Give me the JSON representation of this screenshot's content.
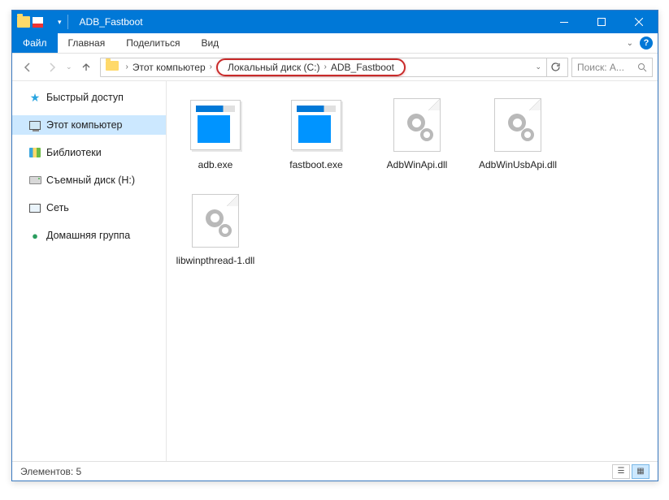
{
  "title": "ADB_Fastboot",
  "ribbon": {
    "file": "Файл",
    "home": "Главная",
    "share": "Поделиться",
    "view": "Вид"
  },
  "breadcrumb": {
    "root": "Этот компьютер",
    "drive": "Локальный диск (C:)",
    "folder": "ADB_Fastboot"
  },
  "search": {
    "placeholder": "Поиск: A..."
  },
  "sidebar": {
    "quick": "Быстрый доступ",
    "pc": "Этот компьютер",
    "lib": "Библиотеки",
    "removable": "Съемный диск (H:)",
    "network": "Сеть",
    "homegroup": "Домашняя группа"
  },
  "files": [
    {
      "name": "adb.exe",
      "type": "exe"
    },
    {
      "name": "fastboot.exe",
      "type": "exe"
    },
    {
      "name": "AdbWinApi.dll",
      "type": "dll"
    },
    {
      "name": "AdbWinUsbApi.dll",
      "type": "dll"
    },
    {
      "name": "libwinpthread-1.dll",
      "type": "dll"
    }
  ],
  "status": {
    "text": "Элементов: 5"
  }
}
